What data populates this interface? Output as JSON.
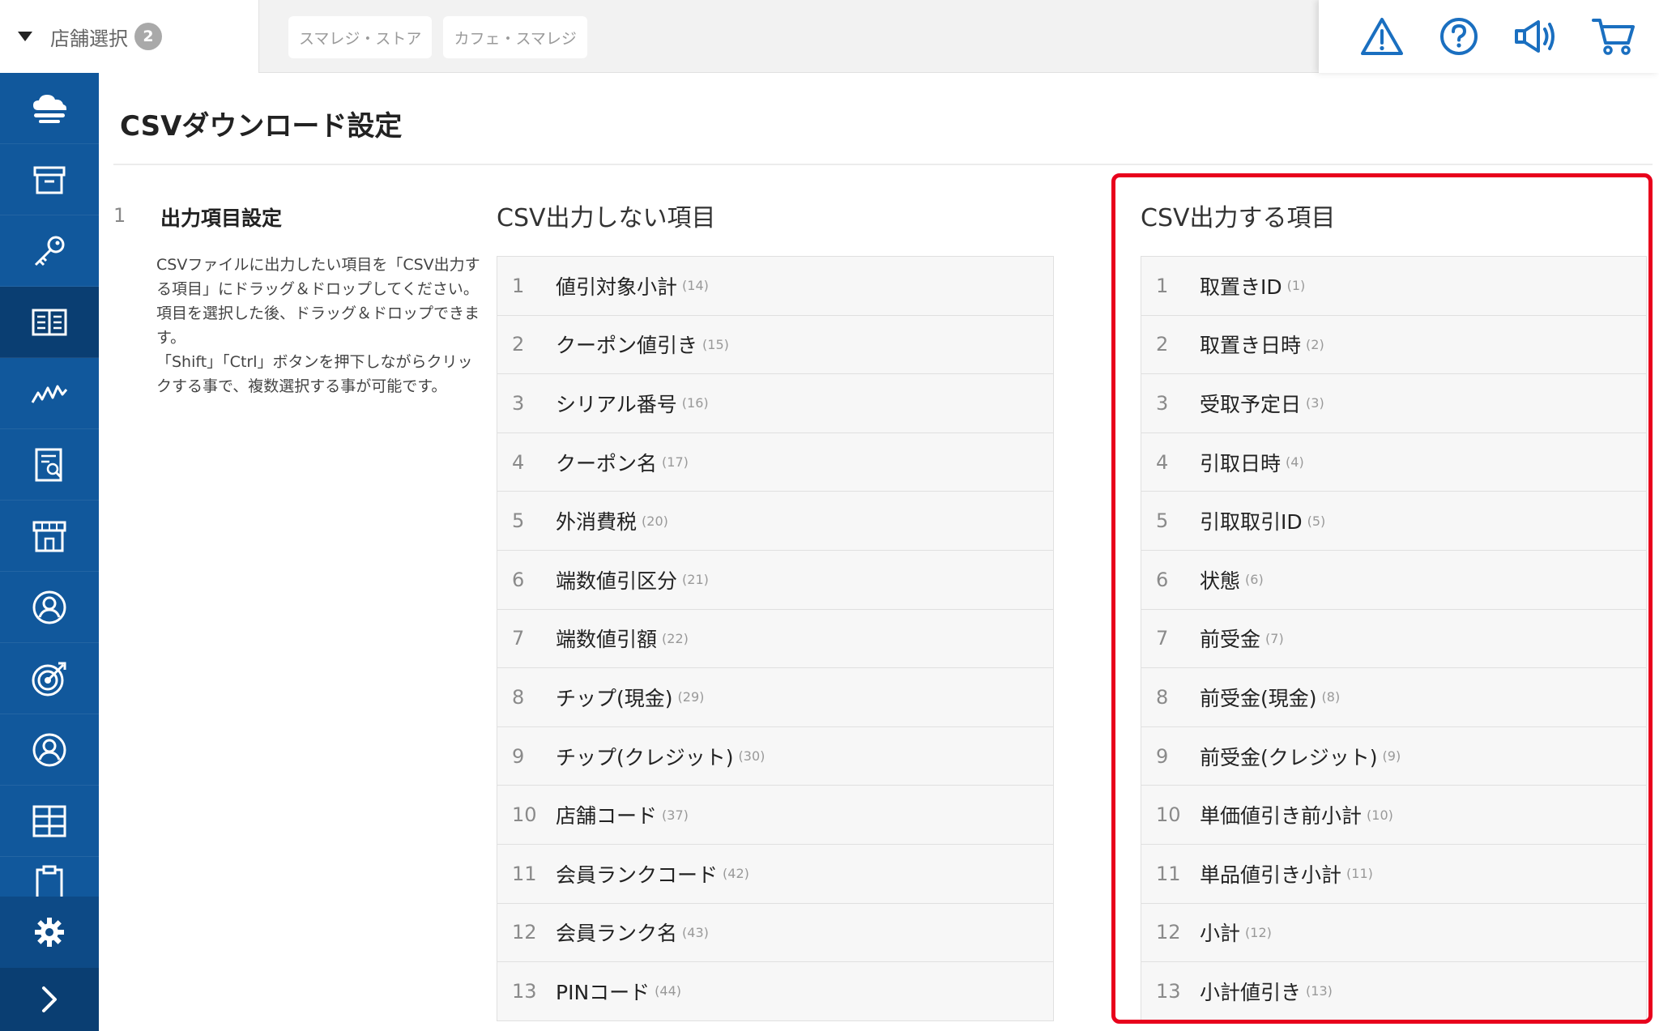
{
  "topbar": {
    "store_select_label": "店舗選択",
    "store_count": "2",
    "stores": [
      "スマレジ・ストア",
      "カフェ・スマレジ"
    ],
    "icons": [
      "warning-icon",
      "help-icon",
      "megaphone-icon",
      "cart-icon"
    ]
  },
  "sidebar": {
    "items": [
      "cloud-icon",
      "archive-icon",
      "key-icon",
      "book-icon",
      "analytics-icon",
      "report-icon",
      "store-icon",
      "user-icon",
      "target-icon",
      "member-icon",
      "grid-icon",
      "clipboard-icon"
    ],
    "active_index": 3,
    "settings": "gear-icon",
    "expand": "chevron-right-icon"
  },
  "page": {
    "title": "CSVダウンロード設定",
    "step_number": "1",
    "step_title": "出力項目設定",
    "step_desc": "CSVファイルに出力したい項目を「CSV出力する項目」にドラッグ＆ドロップしてください。\n項目を選択した後、ドラッグ＆ドロップできます。\n「Shift」「Ctrl」ボタンを押下しながらクリックする事で、複数選択する事が可能です。"
  },
  "left_list": {
    "heading": "CSV出力しない項目",
    "items": [
      {
        "n": "1",
        "label": "値引対象小計",
        "num": "(14)"
      },
      {
        "n": "2",
        "label": "クーポン値引き",
        "num": "(15)"
      },
      {
        "n": "3",
        "label": "シリアル番号",
        "num": "(16)"
      },
      {
        "n": "4",
        "label": "クーポン名",
        "num": "(17)"
      },
      {
        "n": "5",
        "label": "外消費税",
        "num": "(20)"
      },
      {
        "n": "6",
        "label": "端数値引区分",
        "num": "(21)"
      },
      {
        "n": "7",
        "label": "端数値引額",
        "num": "(22)"
      },
      {
        "n": "8",
        "label": "チップ(現金)",
        "num": "(29)"
      },
      {
        "n": "9",
        "label": "チップ(クレジット)",
        "num": "(30)"
      },
      {
        "n": "10",
        "label": "店舗コード",
        "num": "(37)"
      },
      {
        "n": "11",
        "label": "会員ランクコード",
        "num": "(42)"
      },
      {
        "n": "12",
        "label": "会員ランク名",
        "num": "(43)"
      },
      {
        "n": "13",
        "label": "PINコード",
        "num": "(44)"
      }
    ]
  },
  "right_list": {
    "heading": "CSV出力する項目",
    "items": [
      {
        "n": "1",
        "label": "取置きID",
        "num": "(1)"
      },
      {
        "n": "2",
        "label": "取置き日時",
        "num": "(2)"
      },
      {
        "n": "3",
        "label": "受取予定日",
        "num": "(3)"
      },
      {
        "n": "4",
        "label": "引取日時",
        "num": "(4)"
      },
      {
        "n": "5",
        "label": "引取取引ID",
        "num": "(5)"
      },
      {
        "n": "6",
        "label": "状態",
        "num": "(6)"
      },
      {
        "n": "7",
        "label": "前受金",
        "num": "(7)"
      },
      {
        "n": "8",
        "label": "前受金(現金)",
        "num": "(8)"
      },
      {
        "n": "9",
        "label": "前受金(クレジット)",
        "num": "(9)"
      },
      {
        "n": "10",
        "label": "単価値引き前小計",
        "num": "(10)"
      },
      {
        "n": "11",
        "label": "単品値引き小計",
        "num": "(11)"
      },
      {
        "n": "12",
        "label": "小計",
        "num": "(12)"
      },
      {
        "n": "13",
        "label": "小計値引き",
        "num": "(13)"
      }
    ]
  },
  "colors": {
    "sidebar": "#11589c",
    "sidebar_active": "#0a3e72",
    "icon_blue": "#1a6fc0",
    "highlight": "#e8001c"
  }
}
